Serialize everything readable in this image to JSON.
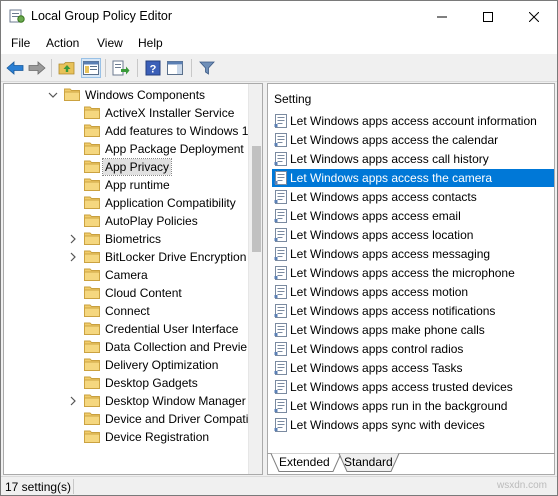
{
  "window": {
    "title": "Local Group Policy Editor"
  },
  "menu": {
    "items": [
      "File",
      "Action",
      "View",
      "Help"
    ]
  },
  "tree": {
    "items": [
      {
        "label": "Windows Components",
        "expander": "expanded",
        "selected": false
      },
      {
        "label": "ActiveX Installer Service",
        "expander": "none",
        "selected": false
      },
      {
        "label": "Add features to Windows 1",
        "expander": "none",
        "selected": false
      },
      {
        "label": "App Package Deployment",
        "expander": "none",
        "selected": false
      },
      {
        "label": "App Privacy",
        "expander": "none",
        "selected": true
      },
      {
        "label": "App runtime",
        "expander": "none",
        "selected": false
      },
      {
        "label": "Application Compatibility",
        "expander": "none",
        "selected": false
      },
      {
        "label": "AutoPlay Policies",
        "expander": "none",
        "selected": false
      },
      {
        "label": "Biometrics",
        "expander": "collapsed",
        "selected": false
      },
      {
        "label": "BitLocker Drive Encryption",
        "expander": "collapsed",
        "selected": false
      },
      {
        "label": "Camera",
        "expander": "none",
        "selected": false
      },
      {
        "label": "Cloud Content",
        "expander": "none",
        "selected": false
      },
      {
        "label": "Connect",
        "expander": "none",
        "selected": false
      },
      {
        "label": "Credential User Interface",
        "expander": "none",
        "selected": false
      },
      {
        "label": "Data Collection and Previe",
        "expander": "none",
        "selected": false
      },
      {
        "label": "Delivery Optimization",
        "expander": "none",
        "selected": false
      },
      {
        "label": "Desktop Gadgets",
        "expander": "none",
        "selected": false
      },
      {
        "label": "Desktop Window Manager",
        "expander": "collapsed",
        "selected": false
      },
      {
        "label": "Device and Driver Compati",
        "expander": "none",
        "selected": false
      },
      {
        "label": "Device Registration",
        "expander": "none",
        "selected": false
      }
    ]
  },
  "settings": {
    "column_header": "Setting",
    "rows": [
      {
        "label": "Let Windows apps access account information",
        "selected": false
      },
      {
        "label": "Let Windows apps access the calendar",
        "selected": false
      },
      {
        "label": "Let Windows apps access call history",
        "selected": false
      },
      {
        "label": "Let Windows apps access the camera",
        "selected": true
      },
      {
        "label": "Let Windows apps access contacts",
        "selected": false
      },
      {
        "label": "Let Windows apps access email",
        "selected": false
      },
      {
        "label": "Let Windows apps access location",
        "selected": false
      },
      {
        "label": "Let Windows apps access messaging",
        "selected": false
      },
      {
        "label": "Let Windows apps access the microphone",
        "selected": false
      },
      {
        "label": "Let Windows apps access motion",
        "selected": false
      },
      {
        "label": "Let Windows apps access notifications",
        "selected": false
      },
      {
        "label": "Let Windows apps make phone calls",
        "selected": false
      },
      {
        "label": "Let Windows apps control radios",
        "selected": false
      },
      {
        "label": "Let Windows apps access Tasks",
        "selected": false
      },
      {
        "label": "Let Windows apps access trusted devices",
        "selected": false
      },
      {
        "label": "Let Windows apps run in the background",
        "selected": false
      },
      {
        "label": "Let Windows apps sync with devices",
        "selected": false
      }
    ]
  },
  "tabs": {
    "extended": "Extended",
    "standard": "Standard",
    "active": "Extended"
  },
  "status": {
    "text": "17 setting(s)"
  },
  "watermark": "wsxdn.com",
  "colors": {
    "selection": "#0078d7",
    "folder": "#e8c25a",
    "accent_blue": "#1e73be"
  },
  "icons": {
    "toolbar": [
      "back-icon",
      "forward-icon",
      "up-folder-icon",
      "show-hide-tree-icon",
      "export-list-icon",
      "help-icon",
      "show-hide-action-pane-icon",
      "filter-icon"
    ]
  }
}
